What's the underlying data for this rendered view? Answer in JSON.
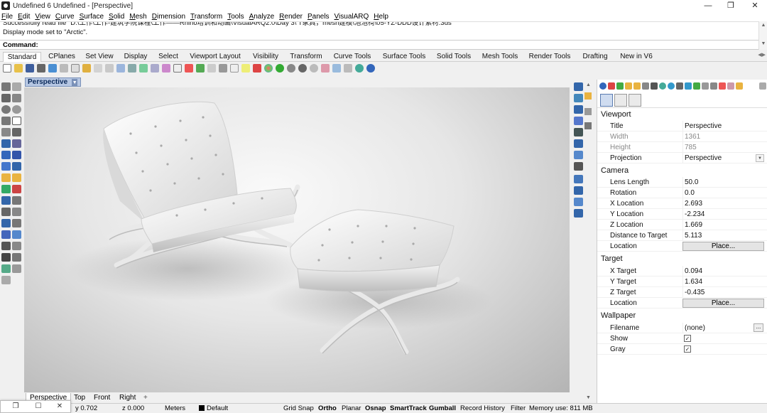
{
  "window": {
    "title": "Undefined 6 Undefined - [Perspective]",
    "minimize": "—",
    "restore": "❐",
    "close": "✕"
  },
  "menu": [
    "File",
    "Edit",
    "View",
    "Curve",
    "Surface",
    "Solid",
    "Mesh",
    "Dimension",
    "Transform",
    "Tools",
    "Analyze",
    "Render",
    "Panels",
    "VisualARQ",
    "Help"
  ],
  "command_history": [
    "Successfully read file \"D:\\工作\\工作-建筑学院课程\\工作——Rhino培训和动画\\VisualARQ2.0\\Day 3\\ T家具，mesh建模\\泡泡椅\\05-YZ-DDD设计素材.3ds\"",
    "Display mode set to \"Arctic\"."
  ],
  "command_prompt": "Command:",
  "toolbar_tabs": [
    "Standard",
    "CPlanes",
    "Set View",
    "Display",
    "Select",
    "Viewport Layout",
    "Visibility",
    "Transform",
    "Curve Tools",
    "Surface Tools",
    "Solid Tools",
    "Mesh Tools",
    "Render Tools",
    "Drafting",
    "New in V6"
  ],
  "active_tab": "Standard",
  "viewport": {
    "label": "Perspective",
    "tabs": [
      "Perspective",
      "Top",
      "Front",
      "Right",
      "+"
    ]
  },
  "properties": {
    "sections": {
      "viewport": "Viewport",
      "camera": "Camera",
      "target": "Target",
      "wallpaper": "Wallpaper"
    },
    "viewport": [
      {
        "k": "Title",
        "v": "Perspective"
      },
      {
        "k": "Width",
        "v": "1361"
      },
      {
        "k": "Height",
        "v": "785"
      },
      {
        "k": "Projection",
        "v": "Perspective"
      }
    ],
    "camera": [
      {
        "k": "Lens Length",
        "v": "50.0"
      },
      {
        "k": "Rotation",
        "v": "0.0"
      },
      {
        "k": "X Location",
        "v": "2.693"
      },
      {
        "k": "Y Location",
        "v": "-2.234"
      },
      {
        "k": "Z Location",
        "v": "1.669"
      },
      {
        "k": "Distance to Target",
        "v": "5.113"
      },
      {
        "k": "Location",
        "v": "Place..."
      }
    ],
    "target": [
      {
        "k": "X Target",
        "v": "0.094"
      },
      {
        "k": "Y Target",
        "v": "1.634"
      },
      {
        "k": "Z Target",
        "v": "-0.435"
      },
      {
        "k": "Location",
        "v": "Place..."
      }
    ],
    "wallpaper": [
      {
        "k": "Filename",
        "v": "(none)"
      },
      {
        "k": "Show",
        "v": "✓"
      },
      {
        "k": "Gray",
        "v": "✓"
      }
    ],
    "dots_button": "..."
  },
  "status": {
    "y": "y 0.702",
    "z": "z 0.000",
    "units": "Meters",
    "layer": "Default",
    "grid_snap": "Grid Snap",
    "ortho": "Ortho",
    "planar": "Planar",
    "osnap": "Osnap",
    "smarttrack": "SmartTrack",
    "gumball": "Gumball",
    "record_history": "Record History",
    "filter": "Filter",
    "memory": "Memory use: 811 MB"
  },
  "mini_window": {
    "restore": "❐",
    "maximize": "☐",
    "close": "✕"
  },
  "colors": {
    "accent": "#b6c7e3",
    "viewport_bg": "#d6d6d6"
  }
}
